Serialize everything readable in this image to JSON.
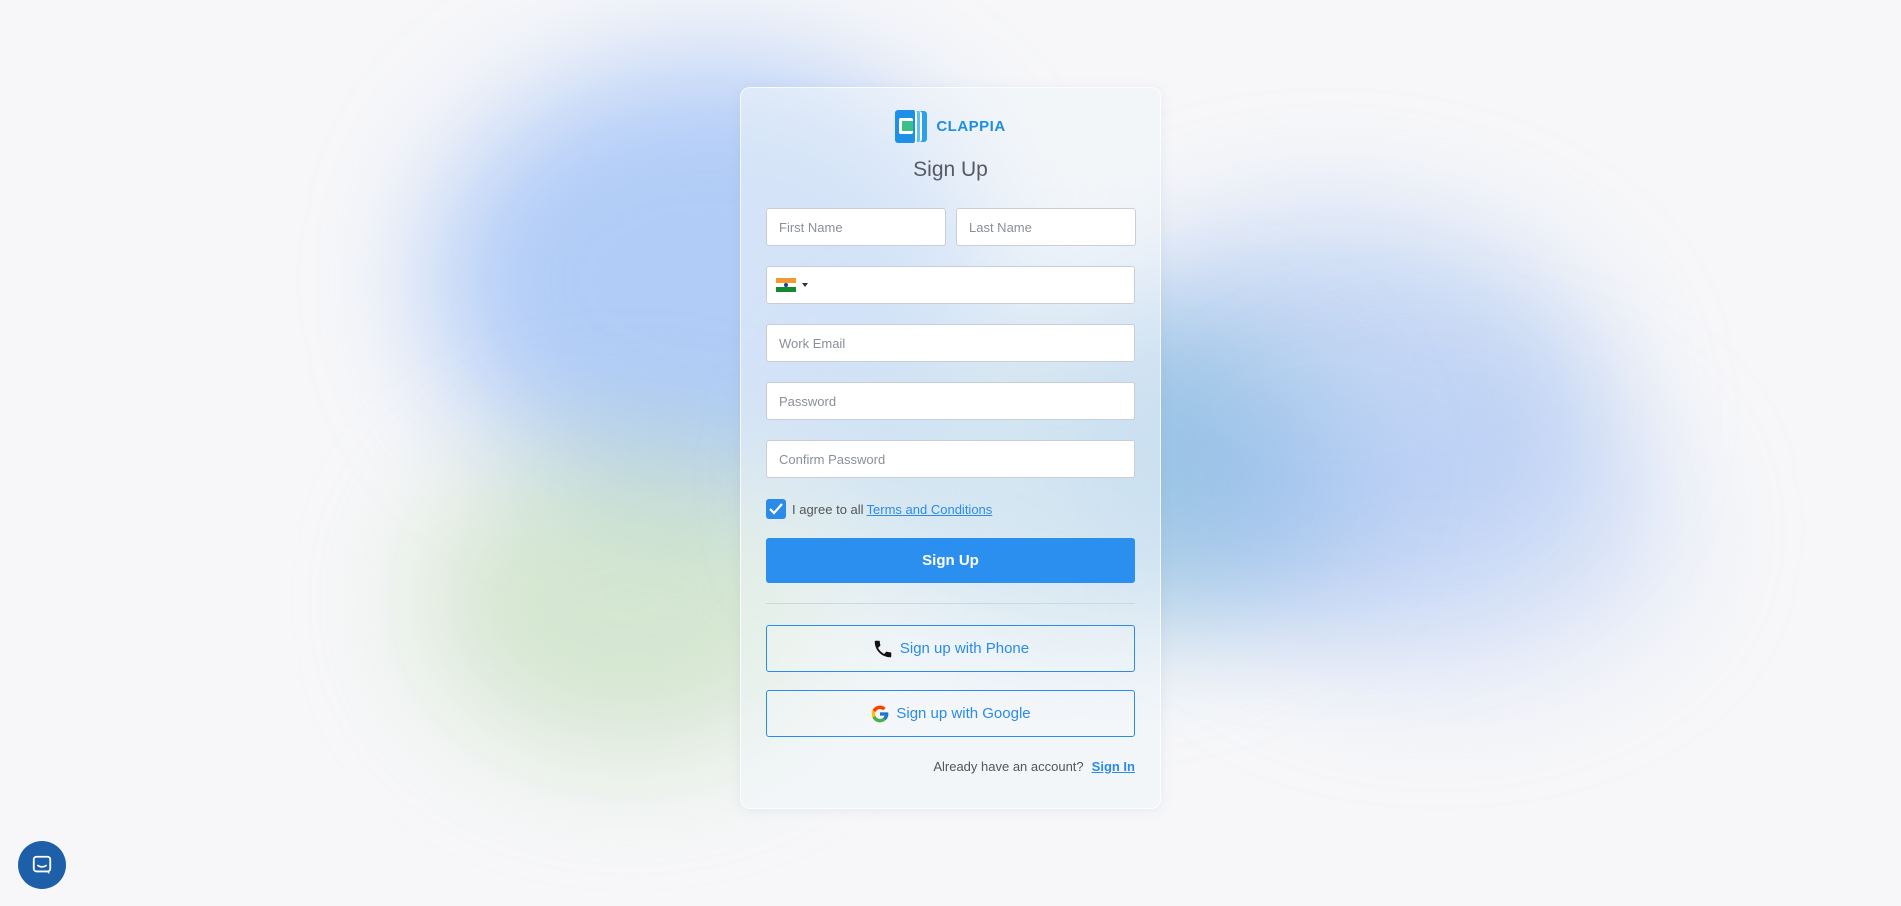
{
  "brand": {
    "name": "CLAPPIA"
  },
  "title": "Sign Up",
  "form": {
    "first_name_placeholder": "First Name",
    "last_name_placeholder": "Last Name",
    "phone_country": "India",
    "phone_value": "",
    "work_email_placeholder": "Work Email",
    "password_placeholder": "Password",
    "confirm_password_placeholder": "Confirm Password"
  },
  "terms": {
    "checked": true,
    "prefix": "I agree to all",
    "link": "Terms and Conditions"
  },
  "buttons": {
    "signup": "Sign Up",
    "signup_phone": "Sign up with Phone",
    "signup_google": "Sign up with Google"
  },
  "footer": {
    "question": "Already have an account?",
    "signin_link": "Sign In"
  },
  "colors": {
    "accent": "#2b8fef",
    "brand": "#1d8fe0",
    "chat": "#1d5fa8"
  },
  "icons": {
    "phone": "phone-icon",
    "google": "google-icon",
    "chat": "chat-icon"
  }
}
